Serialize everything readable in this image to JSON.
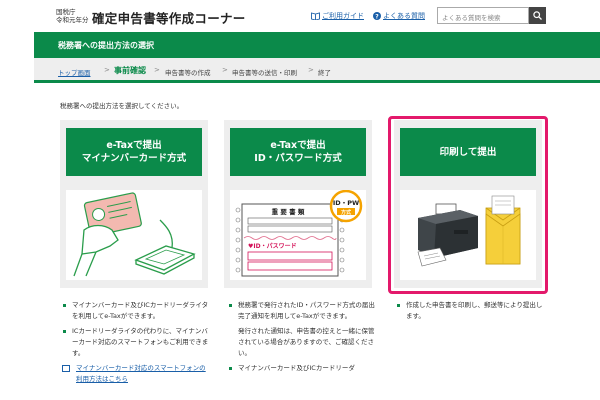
{
  "header": {
    "agency_line1": "国税庁",
    "agency_line2": "令和元年分",
    "title": "確定申告書等作成コーナー",
    "guide_link": "ご利用ガイド",
    "faq_link": "よくある質問",
    "search_placeholder": "よくある質問を検索",
    "search_icon": "magnifier-icon"
  },
  "section_title": "税務署への提出方法の選択",
  "breadcrumb": {
    "items": [
      "トップ画面",
      "事前確認",
      "申告書等の作成",
      "申告書等の送信・印刷",
      "終了"
    ],
    "current_index": 1,
    "separator": ">"
  },
  "instruction": "税務署への提出方法を選択してください。",
  "options": [
    {
      "line1": "e-Taxで提出",
      "line2": "マイナンバーカード方式",
      "selected": false,
      "illustration": "mynumber-card-reader-illustration"
    },
    {
      "line1": "e-Taxで提出",
      "line2": "ID・パスワード方式",
      "selected": false,
      "illustration": "id-password-form-illustration",
      "badge_line1": "ID・PW",
      "badge_line2": "方式",
      "form_heading": "重 要 書 類",
      "form_label": "♥ID・パスワード"
    },
    {
      "line1": "印刷して提出",
      "line2": "",
      "selected": true,
      "illustration": "printer-envelope-illustration"
    }
  ],
  "descriptions": {
    "col1": [
      "マイナンバーカード及びICカードリーダライタを利用してe-Taxができます。",
      "ICカードリーダライタの代わりに、マイナンバーカード対応のスマートフォンもご利用できます。"
    ],
    "col1_link": "マイナンバーカード対応のスマートフォンの利用方法はこちら",
    "col2": [
      "税務署で発行されたID・パスワード方式の届出完了通知を利用してe-Taxができます。",
      "発行された通知は、申告書の控えと一緒に保管されている場合がありますので、ご確認ください。",
      "マイナンバーカード及びICカードリーダ"
    ],
    "col3": [
      "作成した申告書を印刷し、郵送等により提出します。"
    ]
  },
  "colors": {
    "brand_green": "#0b8a4a",
    "selection_pink": "#e3196b",
    "link_blue": "#1a5fa8"
  }
}
